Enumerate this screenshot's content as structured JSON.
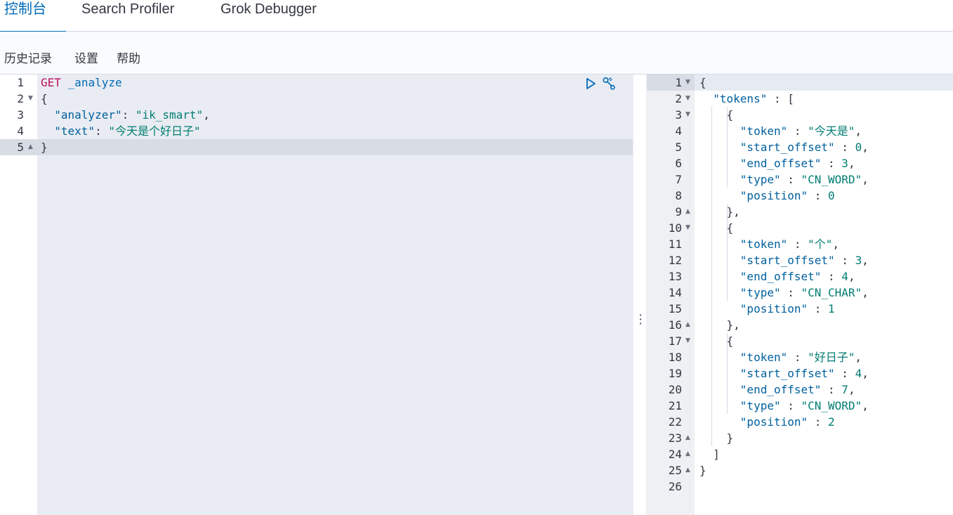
{
  "tabs": [
    {
      "label": "控制台",
      "active": true
    },
    {
      "label": "Search Profiler",
      "active": false
    },
    {
      "label": "Grok Debugger",
      "active": false
    }
  ],
  "toolbar": {
    "history": "历史记录",
    "settings": "设置",
    "help": "帮助"
  },
  "colors": {
    "accent": "#006bb8",
    "method": "#bd0f5a",
    "string": "#017d73",
    "key": "#00609e"
  },
  "request": {
    "line_numbers": [
      "1",
      "2",
      "3",
      "4",
      "5"
    ],
    "method": "GET",
    "url": "_analyze",
    "open_brace": "{",
    "close_brace": "}",
    "analyzer_key": "\"analyzer\"",
    "analyzer_value": "\"ik_smart\"",
    "text_key": "\"text\"",
    "text_value": "\"今天是个好日子\"",
    "icons": [
      "play-icon",
      "wrench-icon"
    ]
  },
  "response": {
    "line_numbers": [
      "1",
      "2",
      "3",
      "4",
      "5",
      "6",
      "7",
      "8",
      "9",
      "10",
      "11",
      "12",
      "13",
      "14",
      "15",
      "16",
      "17",
      "18",
      "19",
      "20",
      "21",
      "22",
      "23",
      "24",
      "25",
      "26"
    ],
    "tokens_key": "\"tokens\"",
    "tokens": [
      {
        "token": "\"今天是\"",
        "start_offset": "0",
        "end_offset": "3",
        "type": "\"CN_WORD\"",
        "position": "0"
      },
      {
        "token": "\"个\"",
        "start_offset": "3",
        "end_offset": "4",
        "type": "\"CN_CHAR\"",
        "position": "1"
      },
      {
        "token": "\"好日子\"",
        "start_offset": "4",
        "end_offset": "7",
        "type": "\"CN_WORD\"",
        "position": "2"
      }
    ],
    "labels": {
      "token": "\"token\"",
      "start_offset": "\"start_offset\"",
      "end_offset": "\"end_offset\"",
      "type": "\"type\"",
      "position": "\"position\""
    }
  }
}
